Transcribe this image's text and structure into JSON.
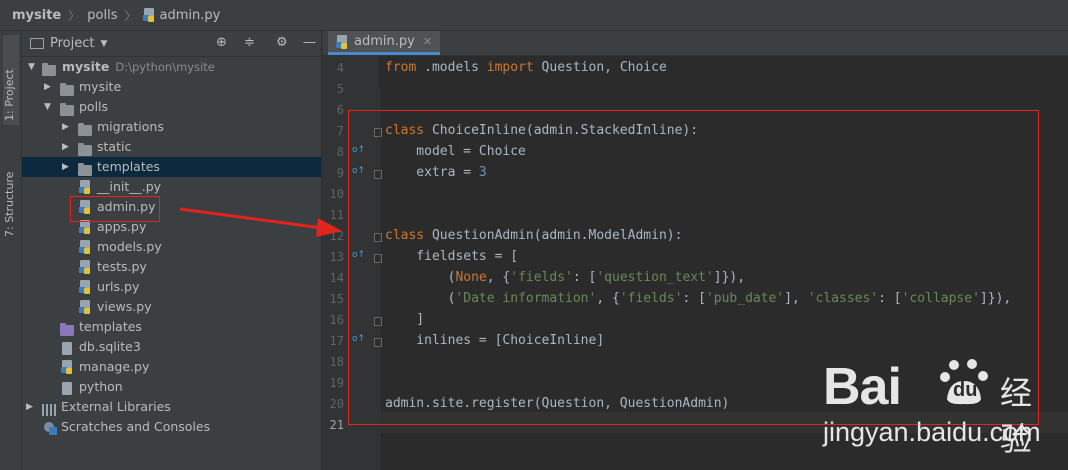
{
  "breadcrumb": {
    "project": "mysite",
    "folder": "polls",
    "file": "admin.py"
  },
  "sidebar_tabs": {
    "project": "1: Project",
    "structure": "7: Structure"
  },
  "project_panel": {
    "title": "Project",
    "tree": [
      {
        "label": "mysite",
        "path": "D:\\python\\mysite",
        "bold": true
      },
      {
        "label": "mysite"
      },
      {
        "label": "polls"
      },
      {
        "label": "migrations"
      },
      {
        "label": "static"
      },
      {
        "label": "templates"
      },
      {
        "label": "__init__.py"
      },
      {
        "label": "admin.py"
      },
      {
        "label": "apps.py"
      },
      {
        "label": "models.py"
      },
      {
        "label": "tests.py"
      },
      {
        "label": "urls.py"
      },
      {
        "label": "views.py"
      },
      {
        "label": "templates"
      },
      {
        "label": "db.sqlite3"
      },
      {
        "label": "manage.py"
      },
      {
        "label": "python"
      },
      {
        "label": "External Libraries"
      },
      {
        "label": "Scratches and Consoles"
      }
    ]
  },
  "editor": {
    "tab_label": "admin.py",
    "line_numbers": [
      "4",
      "5",
      "6",
      "7",
      "8",
      "9",
      "10",
      "11",
      "12",
      "13",
      "14",
      "15",
      "16",
      "17",
      "18",
      "19",
      "20",
      "21"
    ],
    "lines": {
      "l4": {
        "from": "from",
        "mod": " .models ",
        "imp": "import",
        "rest": " Question, Choice"
      },
      "l7": {
        "kw": "class",
        "rest": " ChoiceInline(admin.StackedInline):"
      },
      "l8": "    model = Choice",
      "l9": {
        "pre": "    extra = ",
        "num": "3"
      },
      "l12": {
        "kw": "class",
        "rest": " QuestionAdmin(admin.ModelAdmin):"
      },
      "l13": "    fieldsets = [",
      "l14": {
        "a": "        (",
        "none": "None",
        "b": ", {",
        "s1": "'fields'",
        "c": ": [",
        "s2": "'question_text'",
        "d": "]}),"
      },
      "l15": {
        "a": "        (",
        "s1": "'Date information'",
        "b": ", {",
        "s2": "'fields'",
        "c": ": [",
        "s3": "'pub_date'",
        "d": "], ",
        "s4": "'classes'",
        "e": ": [",
        "s5": "'collapse'",
        "f": "]}),"
      },
      "l16": "    ]",
      "l17": "    inlines = [ChoiceInline]",
      "l20": "admin.site.register(Question, QuestionAdmin)"
    }
  },
  "watermark": {
    "bai": "Bai",
    "du": "du",
    "jingyan": "经验",
    "url": "jingyan.baidu.com"
  },
  "colors": {
    "keyword": "#cc7832",
    "string": "#6a8759",
    "annotation": "#e0251f",
    "selection": "#0d293e"
  }
}
